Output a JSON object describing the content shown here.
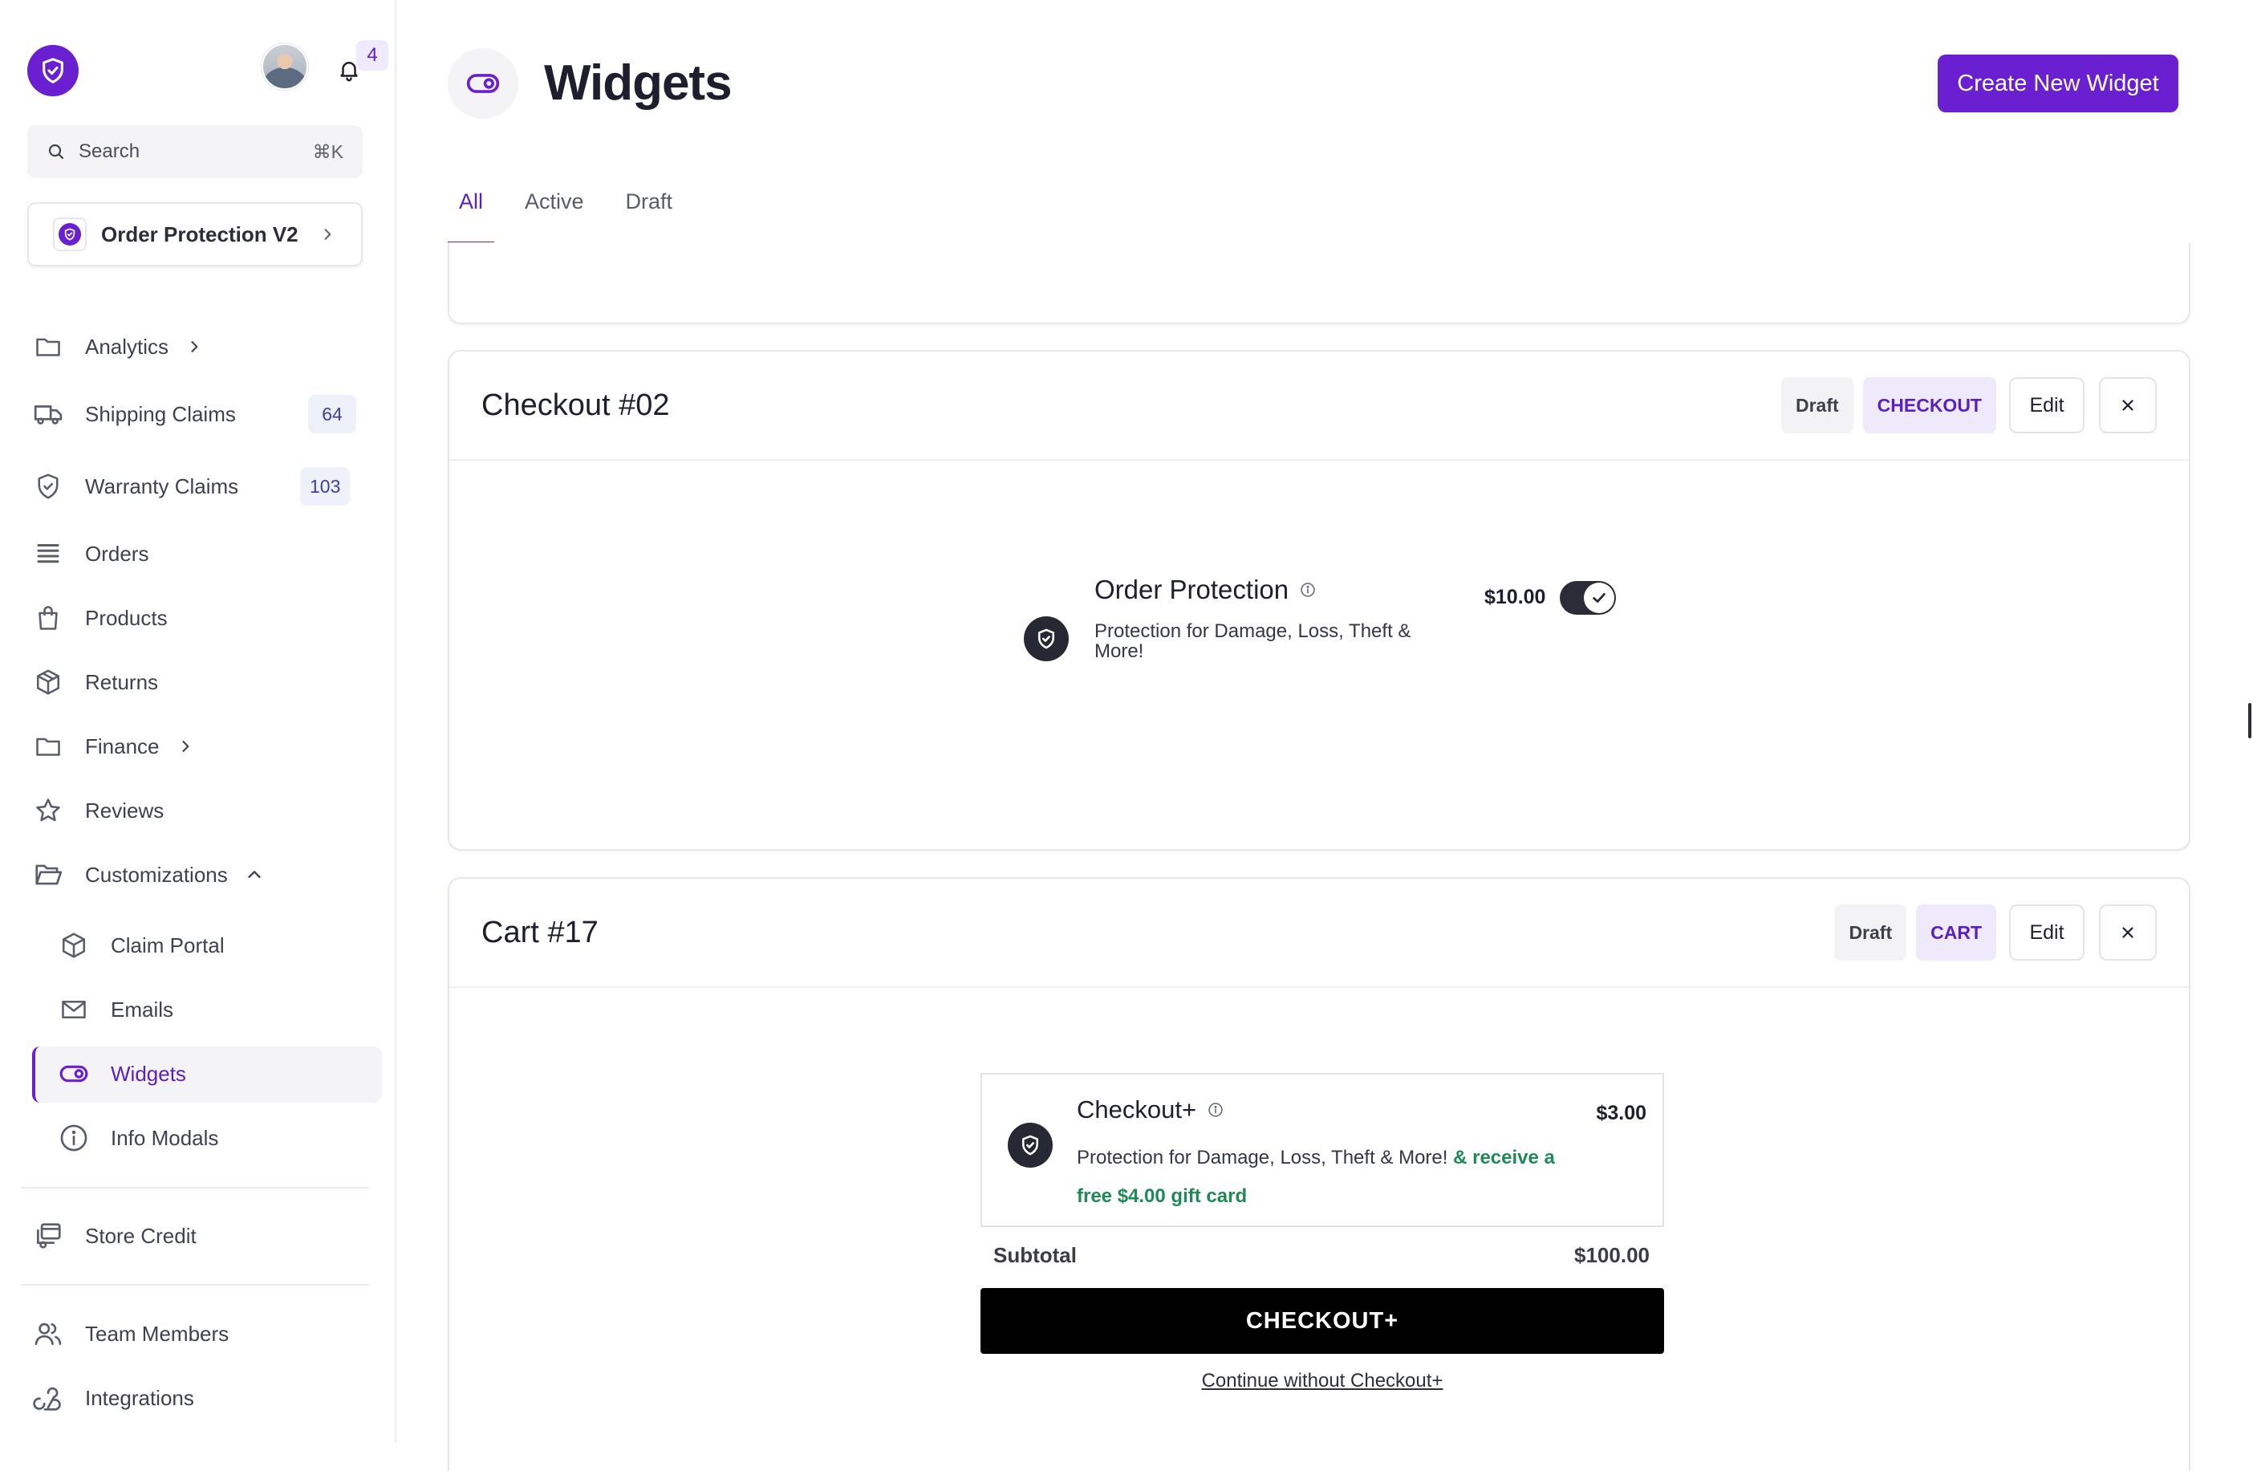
{
  "sidebar": {
    "notifications_count": "4",
    "search": {
      "label": "Search",
      "shortcut": "⌘K"
    },
    "workspace": {
      "name": "Order Protection V2"
    },
    "nav": {
      "analytics": "Analytics",
      "shipping_claims": "Shipping Claims",
      "shipping_claims_count": "64",
      "warranty_claims": "Warranty Claims",
      "warranty_claims_count": "103",
      "orders": "Orders",
      "products": "Products",
      "returns": "Returns",
      "finance": "Finance",
      "reviews": "Reviews",
      "customizations": "Customizations",
      "claim_portal": "Claim Portal",
      "emails": "Emails",
      "widgets": "Widgets",
      "info_modals": "Info Modals",
      "store_credit": "Store Credit",
      "team_members": "Team Members",
      "integrations": "Integrations"
    }
  },
  "header": {
    "title": "Widgets",
    "create_button": "Create New Widget"
  },
  "tabs": [
    "All",
    "Active",
    "Draft"
  ],
  "widgets": [
    {
      "title": "Checkout #02",
      "status": "Draft",
      "type": "CHECKOUT",
      "edit_label": "Edit",
      "preview": {
        "title": "Order Protection",
        "description": "Protection for Damage, Loss, Theft & More!",
        "price": "$10.00",
        "toggle_on": true
      }
    },
    {
      "title": "Cart #17",
      "status": "Draft",
      "type": "CART",
      "edit_label": "Edit",
      "preview": {
        "title": "Checkout+",
        "price": "$3.00",
        "description": "Protection for Damage, Loss, Theft & More!",
        "promo": "& receive a free $4.00 gift card",
        "subtotal_label": "Subtotal",
        "subtotal_value": "$100.00",
        "checkout_button": "CHECKOUT+",
        "continue_link": "Continue without Checkout+"
      }
    }
  ],
  "colors": {
    "brand": "#6a1fd0",
    "promo": "#1f8a55",
    "badge_bg": "#eeeafc"
  },
  "icons": [
    "shield-check-icon",
    "bell-icon",
    "search-icon",
    "folder-icon",
    "truck-icon",
    "shield-icon",
    "list-icon",
    "bag-icon",
    "box-icon",
    "star-icon",
    "folder-open-icon",
    "envelope-icon",
    "toggle-icon",
    "info-icon",
    "credit-icon",
    "users-icon",
    "webhook-icon",
    "chevron-right-icon",
    "chevron-up-icon",
    "close-icon",
    "check-icon"
  ]
}
